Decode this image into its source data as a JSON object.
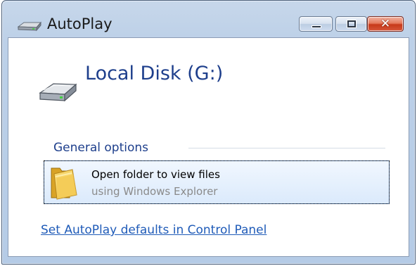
{
  "window": {
    "title": "AutoPlay",
    "title_icon": "drive-icon",
    "controls": {
      "minimize_icon": "minimize-icon",
      "maximize_icon": "maximize-icon",
      "close_glyph": "✕",
      "close_icon": "close-icon"
    }
  },
  "device": {
    "name": "Local Disk (G:)",
    "icon": "hard-drive-icon"
  },
  "section": {
    "label": "General options"
  },
  "options": [
    {
      "title": "Open folder to view files",
      "subtitle": "using Windows Explorer",
      "icon": "folder-icon"
    }
  ],
  "footer": {
    "link_label": "Set AutoPlay defaults in Control Panel"
  },
  "colors": {
    "title_accent": "#1e3f8c",
    "link": "#1f5bb8",
    "close_button": "#c7391a",
    "selection_border": "#6f9ad3"
  }
}
